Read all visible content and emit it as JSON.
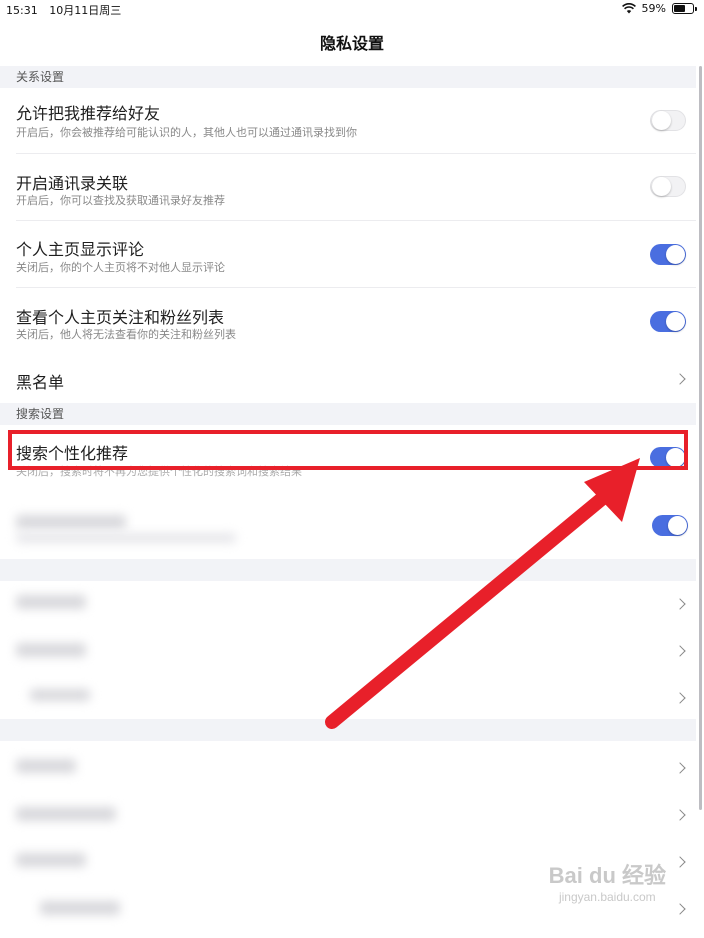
{
  "status_bar": {
    "time": "15:31",
    "date": "10月11日周三",
    "battery": "59%"
  },
  "nav": {
    "title": "隐私设置"
  },
  "sections": {
    "relationship": {
      "header": "关系设置",
      "items": [
        {
          "title": "允许把我推荐给好友",
          "desc": "开启后，你会被推荐给可能认识的人，其他人也可以通过通讯录找到你",
          "toggle": "off"
        },
        {
          "title": "开启通讯录关联",
          "desc": "开启后，你可以查找及获取通讯录好友推荐",
          "toggle": "off"
        },
        {
          "title": "个人主页显示评论",
          "desc": "关闭后，你的个人主页将不对他人显示评论",
          "toggle": "on"
        },
        {
          "title": "查看个人主页关注和粉丝列表",
          "desc": "关闭后，他人将无法查看你的关注和粉丝列表",
          "toggle": "on"
        },
        {
          "title": "黑名单"
        }
      ]
    },
    "search": {
      "header": "搜索设置",
      "items": [
        {
          "title": "搜索个性化推荐",
          "desc": "关闭后，搜索时将不再为您提供个性化的搜索词和搜索结果",
          "toggle": "on"
        }
      ]
    }
  },
  "watermark": {
    "main": "Bai du 经验",
    "sub": "jingyan.baidu.com"
  },
  "colors": {
    "accent": "#4a6ee0",
    "highlight": "#e8202a"
  }
}
